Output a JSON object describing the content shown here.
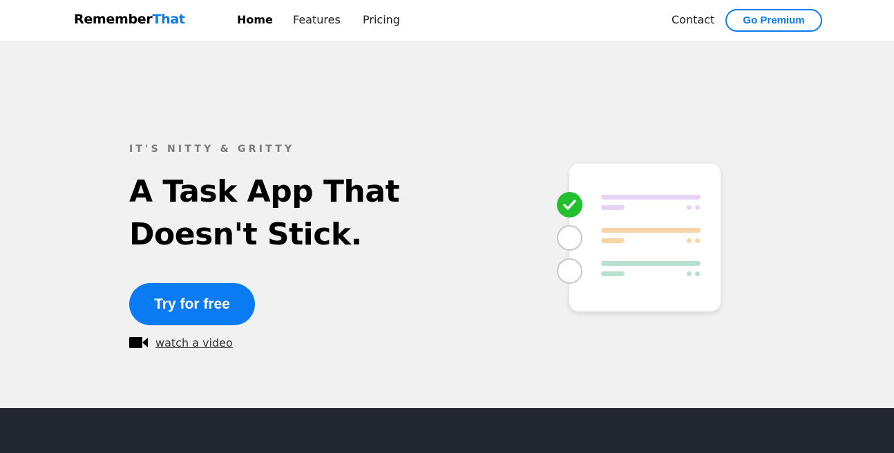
{
  "brand": {
    "name_part1": "Remember",
    "name_part2": "That",
    "accent_color": "#0a7bf2"
  },
  "nav": {
    "links": [
      {
        "label": "Home",
        "active": true
      },
      {
        "label": "Features",
        "active": false
      },
      {
        "label": "Pricing",
        "active": false
      }
    ],
    "contact_label": "Contact",
    "premium_label": "Go Premium"
  },
  "hero": {
    "eyebrow": "IT'S NITTY & GRITTY",
    "headline_line1": "A Task App That",
    "headline_line2": "Doesn't Stick.",
    "cta_label": "Try for free",
    "video_link_label": "watch a video",
    "video_icon": "video-camera-icon"
  },
  "illustration": {
    "tasks": [
      {
        "done": true,
        "color": "#e8d2f7"
      },
      {
        "done": false,
        "color": "#f7d5a6"
      },
      {
        "done": false,
        "color": "#b7e1cf"
      }
    ],
    "check_color": "#22c02f"
  },
  "colors": {
    "hero_bg": "#f1f1f1",
    "footer_bg": "#22272f",
    "primary": "#0a7bf2"
  }
}
